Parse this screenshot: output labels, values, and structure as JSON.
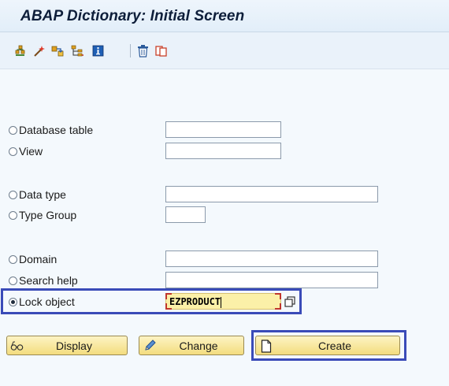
{
  "window": {
    "title": "ABAP Dictionary: Initial Screen"
  },
  "toolbar": {
    "icons": [
      "object-list-icon",
      "magic-wand-icon",
      "where-used-icon",
      "hierarchy-icon",
      "info-icon",
      "delete-icon",
      "copy-icon"
    ]
  },
  "form": {
    "database_table": {
      "label": "Database table",
      "value": "",
      "selected": false
    },
    "view": {
      "label": "View",
      "value": "",
      "selected": false
    },
    "data_type": {
      "label": "Data type",
      "value": "",
      "selected": false
    },
    "type_group": {
      "label": "Type Group",
      "value": "",
      "selected": false
    },
    "domain": {
      "label": "Domain",
      "value": "",
      "selected": false
    },
    "search_help": {
      "label": "Search help",
      "value": "",
      "selected": false
    },
    "lock_object": {
      "label": "Lock object",
      "value": "EZPRODUCT",
      "selected": true
    }
  },
  "buttons": {
    "display": {
      "label": "Display",
      "icon": "glasses-icon"
    },
    "change": {
      "label": "Change",
      "icon": "pencil-icon"
    },
    "create": {
      "label": "Create",
      "icon": "blank-page-icon"
    }
  },
  "colors": {
    "highlight": "#3a4bb8",
    "button_fill": "#f3dd7e",
    "active_field": "#fbf0a8",
    "required_marker": "#c0362c"
  }
}
